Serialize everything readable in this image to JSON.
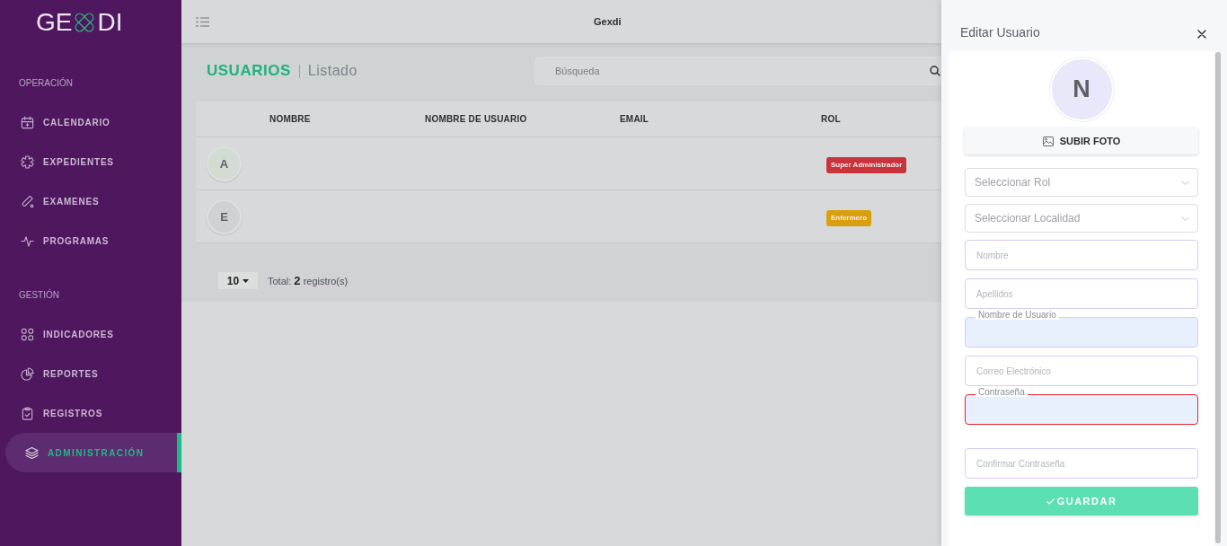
{
  "sidebar": {
    "logo": {
      "left": "GE",
      "right": "DI"
    },
    "sections": [
      {
        "title": "OPERACIÓN",
        "items": [
          {
            "label": "CALENDARIO",
            "selected": false
          },
          {
            "label": "EXPEDIENTES",
            "selected": false
          },
          {
            "label": "EXAMENES",
            "selected": false
          },
          {
            "label": "PROGRAMAS",
            "selected": false
          }
        ]
      },
      {
        "title": "GESTIÓN",
        "items": [
          {
            "label": "INDICADORES",
            "selected": false
          },
          {
            "label": "REPORTES",
            "selected": false
          },
          {
            "label": "REGISTROS",
            "selected": false
          },
          {
            "label": "ADMINISTRACIÓN",
            "selected": true
          }
        ]
      }
    ]
  },
  "header": {
    "title": "Gexdi"
  },
  "page": {
    "title": "USUARIOS",
    "subtitle": "Listado",
    "search": {
      "placeholder": "Búsqueda"
    }
  },
  "table": {
    "columns": [
      "NOMBRE",
      "NOMBRE DE USUARIO",
      "EMAIL",
      "ROL"
    ],
    "rows": [
      {
        "avatar": {
          "initial": "A",
          "color": "#d2dcd2"
        },
        "role": {
          "label": "Super Administrador",
          "color": "#c9333b"
        }
      },
      {
        "avatar": {
          "initial": "E",
          "color": "#d0d1d3"
        },
        "role": {
          "label": "Enfermero",
          "color": "#d99f0d"
        }
      }
    ]
  },
  "pagination": {
    "per_page": "10",
    "total": "Total: **2** registro(s)"
  },
  "drawer": {
    "title": "Editar Usuario",
    "avatar": {
      "initial": "N"
    },
    "upload_button": "SUBIR FOTO",
    "fields": [
      {
        "kind": "select",
        "placeholder": "Seleccionar Rol",
        "error": false
      },
      {
        "kind": "select",
        "placeholder": "Seleccionar Localidad",
        "error": false
      },
      {
        "kind": "input",
        "placeholder": "Nombre",
        "error": false
      },
      {
        "kind": "input",
        "placeholder": "Apellidos",
        "error": false
      },
      {
        "kind": "labeled",
        "label": "Nombre de Usuario",
        "error": false
      },
      {
        "kind": "input",
        "placeholder": "Correo Electrónico",
        "error": false
      },
      {
        "kind": "labeled",
        "label": "Contraseña",
        "error": true
      },
      {
        "kind": "input",
        "placeholder": "Confirmar Contraseña",
        "error": false
      }
    ],
    "save_button": "GUARDAR"
  }
}
